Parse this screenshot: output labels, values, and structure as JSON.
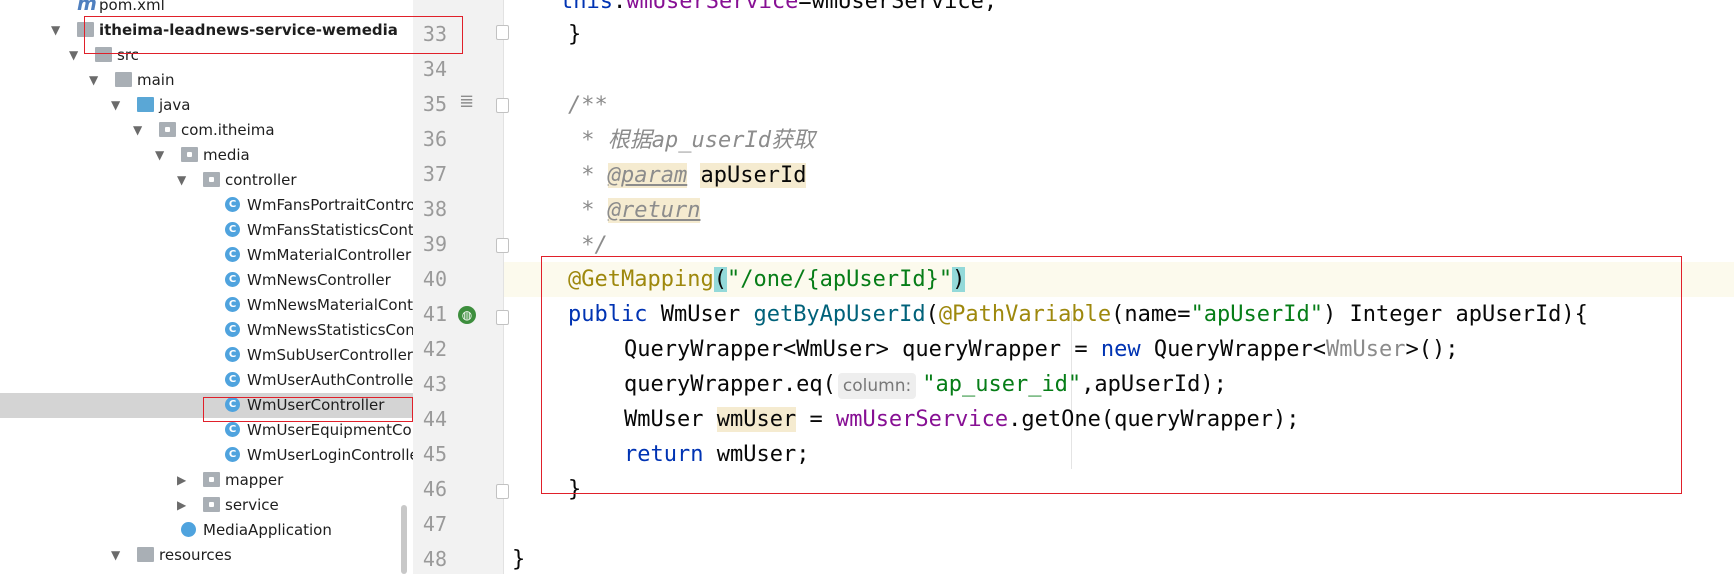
{
  "project_tree": {
    "items": [
      {
        "label": "pom.xml",
        "icon": "maven-file-icon",
        "arrow": "",
        "bold": false
      },
      {
        "label": "itheima-leadnews-service-wemedia",
        "icon": "module-folder-icon",
        "arrow": "▼",
        "bold": true
      },
      {
        "label": "src",
        "icon": "folder-icon",
        "arrow": "▼",
        "bold": false
      },
      {
        "label": "main",
        "icon": "folder-icon",
        "arrow": "▼",
        "bold": false
      },
      {
        "label": "java",
        "icon": "source-folder-icon",
        "arrow": "▼",
        "bold": false
      },
      {
        "label": "com.itheima",
        "icon": "package-icon",
        "arrow": "▼",
        "bold": false
      },
      {
        "label": "media",
        "icon": "package-icon",
        "arrow": "▼",
        "bold": false
      },
      {
        "label": "controller",
        "icon": "package-icon",
        "arrow": "▼",
        "bold": false
      },
      {
        "label": "WmFansPortraitControll",
        "icon": "class-icon",
        "arrow": "",
        "bold": false
      },
      {
        "label": "WmFansStatisticsContr",
        "icon": "class-icon",
        "arrow": "",
        "bold": false
      },
      {
        "label": "WmMaterialController",
        "icon": "class-icon",
        "arrow": "",
        "bold": false
      },
      {
        "label": "WmNewsController",
        "icon": "class-icon",
        "arrow": "",
        "bold": false
      },
      {
        "label": "WmNewsMaterialContro",
        "icon": "class-icon",
        "arrow": "",
        "bold": false
      },
      {
        "label": "WmNewsStatisticsContr",
        "icon": "class-icon",
        "arrow": "",
        "bold": false
      },
      {
        "label": "WmSubUserController",
        "icon": "class-icon",
        "arrow": "",
        "bold": false
      },
      {
        "label": "WmUserAuthController",
        "icon": "class-icon",
        "arrow": "",
        "bold": false
      },
      {
        "label": "WmUserController",
        "icon": "class-icon",
        "arrow": "",
        "bold": false
      },
      {
        "label": "WmUserEquipmentContr",
        "icon": "class-icon",
        "arrow": "",
        "bold": false
      },
      {
        "label": "WmUserLoginController",
        "icon": "class-icon",
        "arrow": "",
        "bold": false
      },
      {
        "label": "mapper",
        "icon": "package-icon",
        "arrow": "▶",
        "bold": false
      },
      {
        "label": "service",
        "icon": "package-icon",
        "arrow": "▶",
        "bold": false
      },
      {
        "label": "MediaApplication",
        "icon": "spring-boot-app-icon",
        "arrow": "",
        "bold": false
      },
      {
        "label": "resources",
        "icon": "resources-folder-icon",
        "arrow": "▼",
        "bold": false
      }
    ],
    "class_icon_letter": "C"
  },
  "editor": {
    "line_numbers": [
      "33",
      "34",
      "35",
      "36",
      "37",
      "38",
      "39",
      "40",
      "41",
      "42",
      "43",
      "44",
      "45",
      "46",
      "47",
      "48"
    ],
    "code": {
      "l32_this": "this",
      "l32_dot": ".",
      "l32_field": "wmUserService",
      "l32_rest": "=wmUserService;",
      "l33": "}",
      "l35": "/**",
      "l36": " * 根据ap_userId获取",
      "l37_star": " * ",
      "l37_tag": "@param",
      "l37_name": "apUserId",
      "l38_star": " * ",
      "l38_tag": "@return",
      "l39": " */",
      "l40_ann": "@GetMapping",
      "l40_open": "(",
      "l40_str": "\"/one/{apUserId}\"",
      "l40_close": ")",
      "l41_kw": "public",
      "l41_type": " WmUser ",
      "l41_method": "getByApUserId",
      "l41_open": "(",
      "l41_ann": "@PathVariable",
      "l41_name": "(name=",
      "l41_str": "\"apUserId\"",
      "l41_rest": ") Integer apUserId){",
      "l42_a": "QueryWrapper<WmUser> queryWrapper = ",
      "l42_kw": "new",
      "l42_b": " QueryWrapper<",
      "l42_gray": "WmUser",
      "l42_c": ">();",
      "l43_a": "queryWrapper.eq(",
      "l43_hint": "column:",
      "l43_str": "\"ap_user_id\"",
      "l43_b": ",apUserId);",
      "l44_a": "WmUser ",
      "l44_var": "wmUser",
      "l44_b": " = ",
      "l44_field": "wmUserService",
      "l44_c": ".getOne(queryWrapper);",
      "l45_kw": "return",
      "l45_rest": " wmUser;",
      "l46": "}",
      "l48": "}"
    },
    "gutter_icons": [
      "documentation-icon",
      "web-endpoint-icon"
    ]
  },
  "colors": {
    "keyword": "#0033b3",
    "annotation": "#9e880d",
    "string": "#067d17",
    "field": "#871094",
    "comment": "#8c8c8c",
    "highlight_box": "#e0202a"
  }
}
